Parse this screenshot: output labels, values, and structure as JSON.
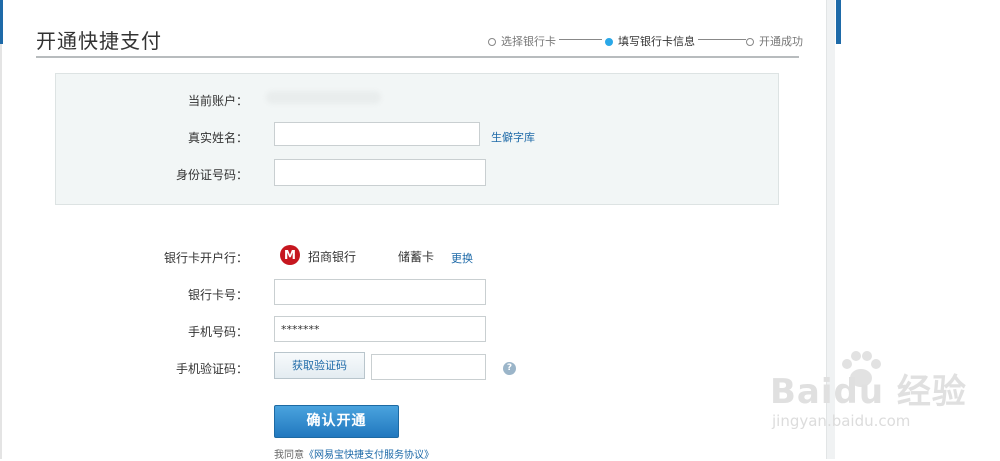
{
  "page": {
    "title": "开通快捷支付"
  },
  "steps": [
    {
      "label": "选择银行卡",
      "state": "done"
    },
    {
      "label": "填写银行卡信息",
      "state": "active"
    },
    {
      "label": "开通成功",
      "state": "pending"
    }
  ],
  "account": {
    "current_account_label": "当前账户：",
    "real_name_label": "真实姓名：",
    "real_name_value": "",
    "rare_char_link": "生僻字库",
    "id_number_label": "身份证号码：",
    "id_number_value": ""
  },
  "bank": {
    "bank_label": "银行卡开户行：",
    "bank_logo_glyph": "M",
    "bank_name": "招商银行",
    "card_type": "储蓄卡",
    "change_link": "更换",
    "card_number_label": "银行卡号：",
    "card_number_value": "",
    "phone_label": "手机号码：",
    "phone_value": "*******",
    "sms_label": "手机验证码：",
    "get_code_button": "获取验证码",
    "sms_value": "",
    "help_glyph": "?"
  },
  "actions": {
    "confirm_button": "确认开通",
    "agree_prefix": "我同意",
    "agreement_link": "《网易宝快捷支付服务协议》"
  },
  "watermark": {
    "brand": "Baidu 经验",
    "url": "jingyan.baidu.com"
  },
  "colors": {
    "accent": "#1e6aa8",
    "active_step": "#2aa8e8",
    "bank_red": "#c6171f",
    "panel_bg": "#f2f6f6"
  },
  "icons": {
    "step": "circle-dot",
    "help": "question-circle-icon",
    "bank": "cmb-logo-icon"
  }
}
